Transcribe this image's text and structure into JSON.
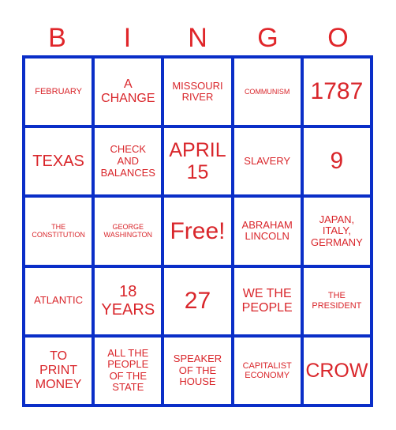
{
  "header": {
    "letters": [
      "B",
      "I",
      "N",
      "G",
      "O"
    ]
  },
  "colors": {
    "text": "#d9262b",
    "grid": "#0a2ec8",
    "background": "#ffffff"
  },
  "board": {
    "rows": [
      [
        {
          "text": "FEBRUARY",
          "size": "s-sm"
        },
        {
          "text": "A\nCHANGE",
          "size": "s-lg"
        },
        {
          "text": "MISSOURI\nRIVER",
          "size": "s-md"
        },
        {
          "text": "COMMUNISM",
          "size": "s-xs"
        },
        {
          "text": "1787",
          "size": "s-huge"
        }
      ],
      [
        {
          "text": "TEXAS",
          "size": "s-xl"
        },
        {
          "text": "CHECK\nAND\nBALANCES",
          "size": "s-md"
        },
        {
          "text": "APRIL\n15",
          "size": "s-xxl"
        },
        {
          "text": "SLAVERY",
          "size": "s-md"
        },
        {
          "text": "9",
          "size": "s-huge"
        }
      ],
      [
        {
          "text": "THE\nCONSTITUTION",
          "size": "s-xs"
        },
        {
          "text": "GEORGE\nWASHINGTON",
          "size": "s-xs"
        },
        {
          "text": "Free!",
          "size": "s-huge"
        },
        {
          "text": "ABRAHAM\nLINCOLN",
          "size": "s-md"
        },
        {
          "text": "JAPAN,\nITALY,\nGERMANY",
          "size": "s-md"
        }
      ],
      [
        {
          "text": "ATLANTIC",
          "size": "s-md"
        },
        {
          "text": "18\nYEARS",
          "size": "s-xl"
        },
        {
          "text": "27",
          "size": "s-huge"
        },
        {
          "text": "WE THE\nPEOPLE",
          "size": "s-lg"
        },
        {
          "text": "THE\nPRESIDENT",
          "size": "s-sm"
        }
      ],
      [
        {
          "text": "TO\nPRINT\nMONEY",
          "size": "s-lg"
        },
        {
          "text": "ALL THE\nPEOPLE\nOF THE\nSTATE",
          "size": "s-md"
        },
        {
          "text": "SPEAKER\nOF THE\nHOUSE",
          "size": "s-md"
        },
        {
          "text": "CAPITALIST\nECONOMY",
          "size": "s-sm"
        },
        {
          "text": "CROW",
          "size": "s-xxl"
        }
      ]
    ]
  }
}
